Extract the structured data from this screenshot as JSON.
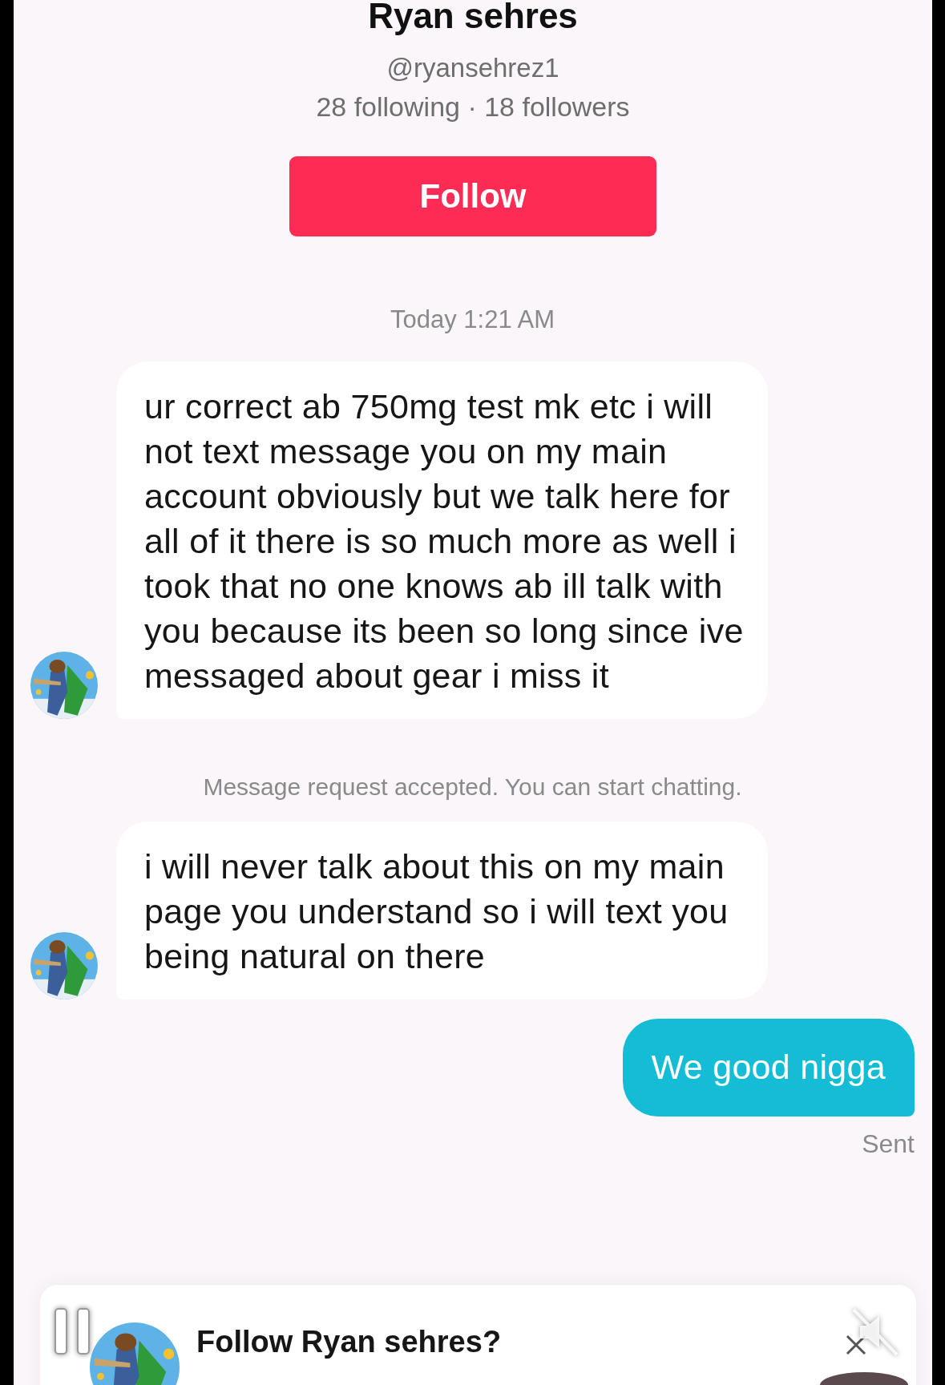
{
  "profile": {
    "name": "Ryan sehres",
    "handle": "@ryansehrez1",
    "stats": "28 following · 18 followers",
    "follow_button": "Follow"
  },
  "messages": [
    {
      "kind": "timestamp",
      "text": "Today 1:21 AM"
    },
    {
      "kind": "incoming",
      "text": "ur correct ab 750mg test mk etc i will not text message you on my main account obviously but we talk here for all of it there is so much more as well i took that no one knows ab ill talk with you because its been so long since ive messaged about gear i miss it"
    },
    {
      "kind": "system",
      "text": "Message request accepted. You can start chatting."
    },
    {
      "kind": "incoming",
      "text": "i will never talk about this on my main page you understand so i will text you being natural on there"
    },
    {
      "kind": "outgoing",
      "text": "We good nigga"
    },
    {
      "kind": "status",
      "text": "Sent"
    }
  ],
  "follow_prompt": {
    "title": "Follow Ryan sehres?"
  }
}
